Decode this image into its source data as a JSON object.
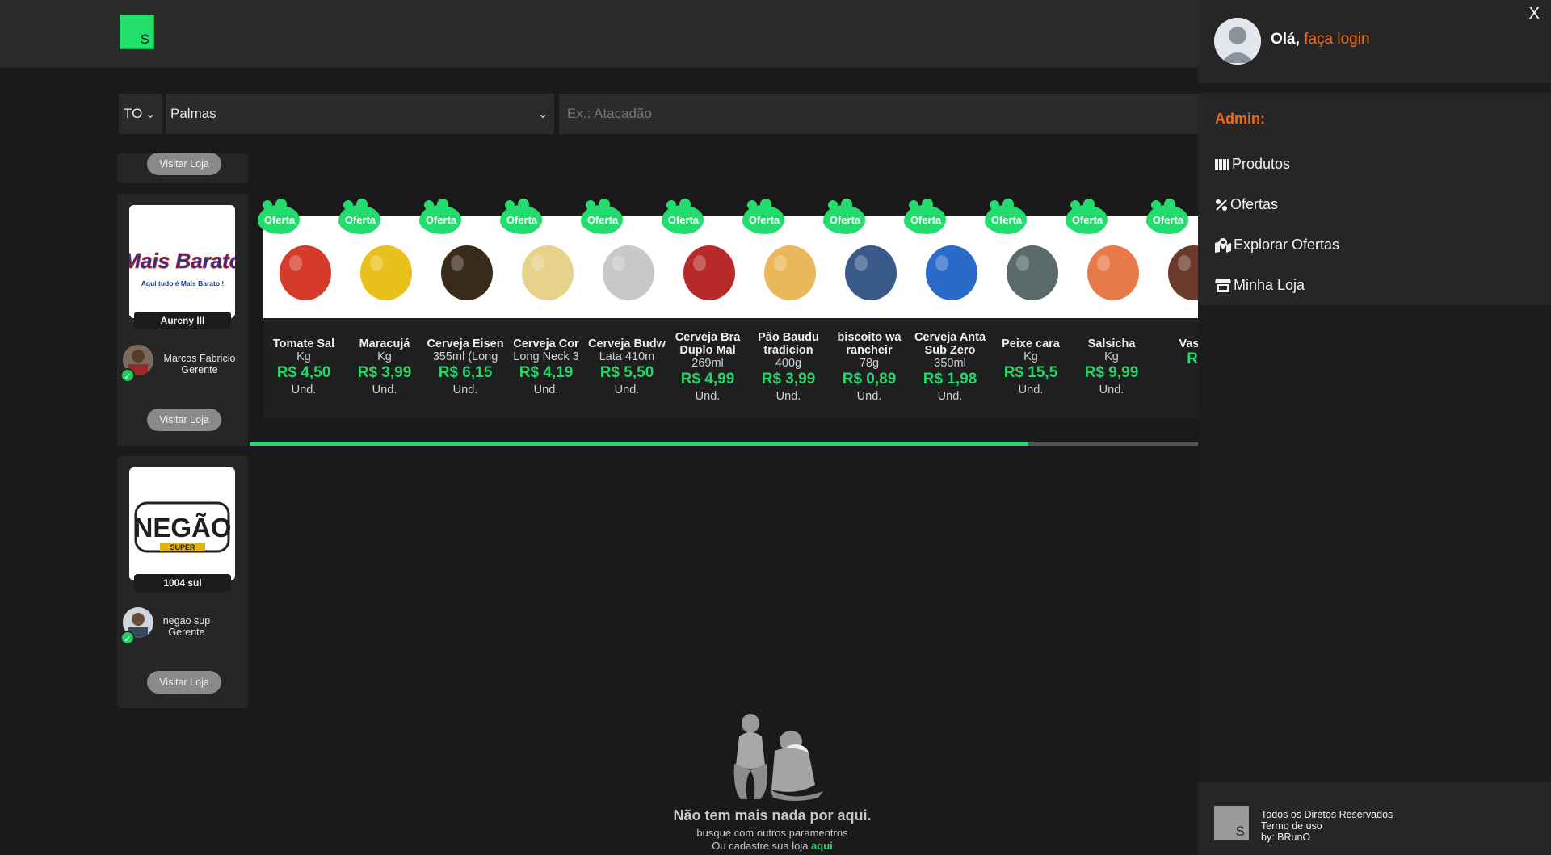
{
  "header": {
    "logo_letter": "S"
  },
  "filters": {
    "state": "TO",
    "city": "Palmas",
    "search_placeholder": "Ex.: Atacadão"
  },
  "stores": [
    {
      "visit_label": "Visitar Loja"
    },
    {
      "logo_text": "Mais Barato",
      "logo_slogan": "Aqui tudo é Mais Barato !",
      "name": "Aureny III",
      "manager": "Marcos Fabricio",
      "role": "Gerente",
      "visit_label": "Visitar Loja"
    },
    {
      "logo_text": "NEGÃO",
      "logo_sub": "SUPER",
      "name": "1004 sul",
      "manager": "negao sup",
      "role": "Gerente",
      "visit_label": "Visitar Loja"
    }
  ],
  "offer_badge": "Oferta",
  "products": [
    {
      "name": "Tomate Sal",
      "qty": "Kg",
      "price": "R$ 4,50",
      "unit": "Und."
    },
    {
      "name": "Maracujá",
      "qty": "Kg",
      "price": "R$ 3,99",
      "unit": "Und."
    },
    {
      "name": "Cerveja Eisen",
      "qty": "355ml (Long",
      "price": "R$ 6,15",
      "unit": "Und."
    },
    {
      "name": "Cerveja Cor",
      "qty": "Long Neck 3",
      "price": "R$ 4,19",
      "unit": "Und."
    },
    {
      "name": "Cerveja Budw",
      "qty": "Lata 410m",
      "price": "R$ 5,50",
      "unit": "Und."
    },
    {
      "name": "Cerveja Bra",
      "name2": "Duplo Mal",
      "qty": "269ml",
      "price": "R$ 4,99",
      "unit": "Und."
    },
    {
      "name": "Pão Baudu",
      "name2": "tradicion",
      "qty": "400g",
      "price": "R$ 3,99",
      "unit": "Und."
    },
    {
      "name": "biscoito wa",
      "name2": "rancheir",
      "qty": "78g",
      "price": "R$ 0,89",
      "unit": "Und."
    },
    {
      "name": "Cerveja Anta",
      "name2": "Sub Zero",
      "qty": "350ml",
      "price": "R$ 1,98",
      "unit": "Und."
    },
    {
      "name": "Peixe cara",
      "qty": "Kg",
      "price": "R$ 15,5",
      "unit": "Und."
    },
    {
      "name": "Salsicha",
      "qty": "Kg",
      "price": "R$ 9,99",
      "unit": "Und."
    },
    {
      "name": "Vass",
      "qty": "",
      "price": "R",
      "unit": ""
    }
  ],
  "carousel_progress": 0.82,
  "empty_state": {
    "title": "Não tem mais nada por aqui.",
    "line1": "busque com outros paramentros",
    "line2": "Ou cadastre sua loja",
    "link": "aqui"
  },
  "drawer": {
    "close": "X",
    "greeting": "Olá,",
    "login": "faça login",
    "admin_label": "Admin:",
    "menu": [
      {
        "label": "Produtos",
        "icon": "barcode-icon"
      },
      {
        "label": "Ofertas",
        "icon": "percent-icon"
      },
      {
        "label": "Explorar Ofertas",
        "icon": "map-pin-icon"
      },
      {
        "label": "Minha Loja",
        "icon": "store-icon"
      }
    ],
    "footer": {
      "logo_letter": "S",
      "rights": "Todos os Diretos Reservados",
      "terms": "Termo de uso",
      "by": "by: BRunO"
    }
  },
  "colors": {
    "accent": "#22dd6e",
    "login": "#f06a1e"
  }
}
